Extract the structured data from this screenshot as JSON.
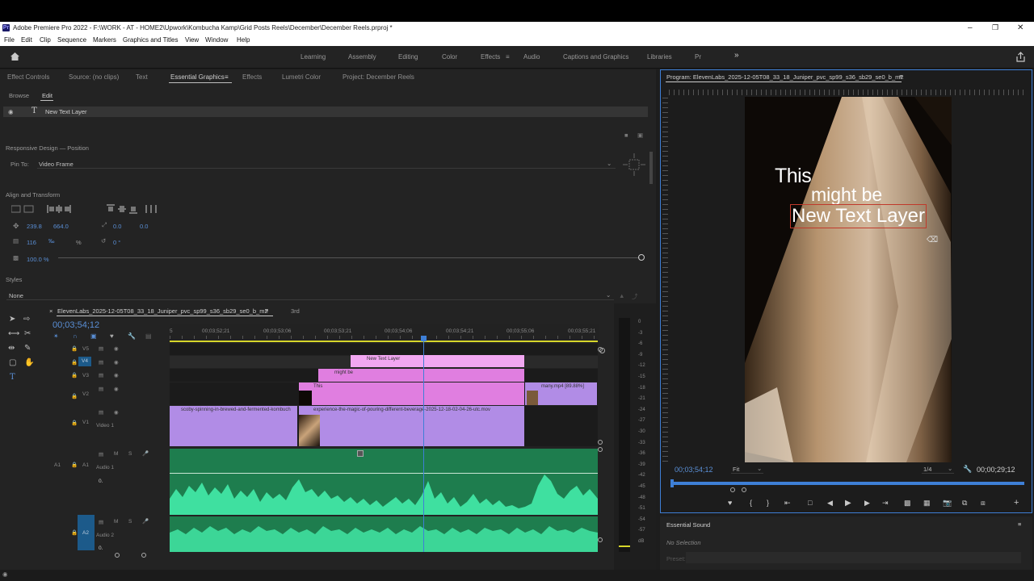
{
  "window": {
    "app_icon": "Pr",
    "title": "Adobe Premiere Pro 2022 - F:\\WORK - AT - HOME2\\Upwork\\Kombucha Kamp\\Grid Posts Reels\\December\\December Reels.prproj *"
  },
  "menu": [
    "File",
    "Edit",
    "Clip",
    "Sequence",
    "Markers",
    "Graphics and Titles",
    "View",
    "Window",
    "Help"
  ],
  "workspaces": [
    "Learning",
    "Assembly",
    "Editing",
    "Color",
    "Effects",
    "Audio",
    "Captions and Graphics",
    "Libraries",
    "Pr"
  ],
  "workspace_active": "Effects",
  "left_tabs": [
    "Effect Controls",
    "Source: (no clips)",
    "Text",
    "Essential Graphics",
    "Effects",
    "Lumetri Color",
    "Project: December Reels"
  ],
  "eg": {
    "subtabs": [
      "Browse",
      "Edit"
    ],
    "layer_name": "New Text Layer",
    "responsive_header": "Responsive Design — Position",
    "pin_label": "Pin To:",
    "pin_value": "Video Frame",
    "align_header": "Align and Transform",
    "pos_x": "239.8",
    "pos_y": "664.0",
    "anchor_x": "0.0",
    "anchor_y": "0.0",
    "scale": "116",
    "scale_unit": "%",
    "rotation": "0 °",
    "opacity": "100.0 %",
    "styles_header": "Styles",
    "styles_value": "None"
  },
  "program": {
    "title": "Program: ElevenLabs_2025-12-05T08_33_18_Juniper_pvc_sp99_s36_sb29_se0_b_m2",
    "text_line1": "This",
    "text_line2": "might be",
    "text_line3": "New Text Layer",
    "timecode": "00;03;54;12",
    "fit": "Fit",
    "resolution": "1/4",
    "duration": "00;00;29;12"
  },
  "timeline": {
    "seq_tab": "ElevenLabs_2025-12-05T08_33_18_Juniper_pvc_sp99_s36_sb29_se0_b_m2",
    "tab2": "3rd",
    "timecode": "00;03;54;12",
    "ruler": [
      "5",
      "00;03;52;21",
      "00;03;53;06",
      "00;03;53;21",
      "00;03;54;06",
      "00;03;54;21",
      "00;03;55;06",
      "00;03;55;21"
    ],
    "tracks": {
      "v5": "V5",
      "v4": "V4",
      "v3": "V3",
      "v2": "V2",
      "v1": "V1",
      "v1_name": "Video 1",
      "a1": "A1",
      "a1_name": "Audio 1",
      "a1_vol": "0.",
      "a2": "A2",
      "a2_name": "Audio 2",
      "a2_vol": "0."
    },
    "clips": {
      "new_text": "New Text Layer",
      "might_be": "might be",
      "this": "This",
      "many": "many.mp4 [89.88%]",
      "scoby": "scoby-spinning-in-brewed-and-fermented-kombuch",
      "experience": "experience-the-magic-of-pouring-different-beverage-2025-12-18-02-04-26-utc.mov",
      "fx": "fx"
    }
  },
  "meters": [
    "0",
    "-3",
    "-6",
    "-9",
    "-12",
    "-15",
    "-18",
    "-21",
    "-24",
    "-27",
    "-30",
    "-33",
    "-36",
    "-39",
    "-42",
    "-45",
    "-48",
    "-51",
    "-54",
    "-57",
    "dB"
  ],
  "essential_sound": {
    "title": "Essential Sound",
    "selection": "No Selection",
    "preset": "Preset:"
  },
  "colors": {
    "accent": "#3e7fd6",
    "graphics_clip": "#e07ee0",
    "graphics_clip_light": "#f2a7f2",
    "video_clip": "#b18ce6",
    "audio_clip": "#1e7d4e",
    "waveform": "#3fe0a0"
  }
}
